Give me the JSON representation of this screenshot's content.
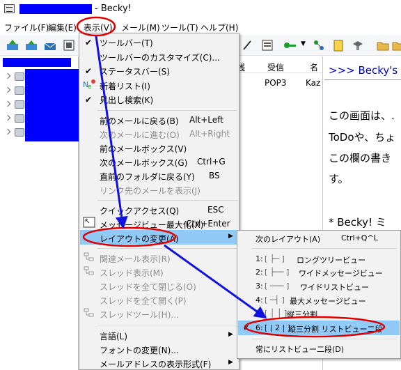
{
  "window": {
    "title_suffix": "- Becky!"
  },
  "menubar": {
    "file": "ファイル(F)",
    "edit": "編集(E)",
    "view": "表示(V)",
    "mail": "メール(M)",
    "tools": "ツール(T)",
    "help": "ヘルプ(H)"
  },
  "list": {
    "columns": [
      "",
      "受信",
      "名"
    ],
    "rows": [
      {
        "type": "POP3",
        "name": "Kaz"
      }
    ]
  },
  "preview": {
    "heading": ">>> Becky's",
    "lines": [
      "この画面は、.",
      "ToDoや、ちょ",
      "この欄の書き",
      "す。",
      "* Becky! ミ"
    ]
  },
  "view_menu": {
    "items": [
      {
        "label": "ツールバー(T)",
        "checked": true,
        "disabled": false
      },
      {
        "label": "ツールバーのカスタマイズ(C)...",
        "checked": false,
        "disabled": false
      },
      {
        "label": "ステータスバー(S)",
        "checked": true,
        "disabled": false
      },
      {
        "label": "新着リスト(I)",
        "checked": false,
        "disabled": false
      },
      {
        "label": "見出し検索(K)",
        "checked": true,
        "disabled": false
      },
      {
        "label": "前のメールに戻る(B)",
        "shortcut": "Alt+Left",
        "disabled": false
      },
      {
        "label": "次のメールに進む(O)",
        "shortcut": "Alt+Right",
        "disabled": true
      },
      {
        "label": "前のメールボックス(V)",
        "disabled": false
      },
      {
        "label": "次のメールボックス(G)",
        "shortcut": "Ctrl+G",
        "disabled": false
      },
      {
        "label": "直前のフォルダに戻る(Y)",
        "shortcut": "BS",
        "disabled": false
      },
      {
        "label": "リンク先のメールを表示(J)",
        "disabled": true
      },
      {
        "label": "クイックアクセス(Q)",
        "shortcut": "ESC",
        "disabled": false
      },
      {
        "label": "メッセージビュー最大化(X)",
        "shortcut": "Ctrl+Enter",
        "disabled": false
      },
      {
        "label": "レイアウトの変更(A)",
        "disabled": false,
        "highlighted": true
      },
      {
        "label": "関連メール表示(R)",
        "disabled": true
      },
      {
        "label": "スレッド表示(M)",
        "disabled": true
      },
      {
        "label": "スレッドを全て閉じる(O)",
        "disabled": true
      },
      {
        "label": "スレッドを全て開く(P)",
        "disabled": true
      },
      {
        "label": "スレッドツール(H)...",
        "disabled": true
      },
      {
        "label": "言語(L)",
        "submenu": true,
        "disabled": false
      },
      {
        "label": "フォントの変更(N)...",
        "disabled": false
      },
      {
        "label": "メールアドレスの表示形式(F)",
        "submenu": true,
        "disabled": false
      }
    ]
  },
  "layout_submenu": {
    "next_layout": {
      "label": "次のレイアウト(A)",
      "shortcut": "Ctrl+Q^L"
    },
    "options": [
      {
        "num": "1:",
        "glyph": "[ ├─ ]",
        "label": "ロングツリービュー"
      },
      {
        "num": "2:",
        "glyph": "[ ├── ]",
        "label": "ワイドメッセージビュー"
      },
      {
        "num": "3:",
        "glyph": "[ ─── ]",
        "label": "ワイドリストビュー"
      },
      {
        "num": "4:",
        "glyph": "[ ─┤ ]",
        "label": "最大メッセージビュー"
      },
      {
        "num": "5:",
        "glyph": "[ │ │ ]",
        "label": "縦三分割"
      },
      {
        "num": "6:",
        "glyph": "[ | 2 | ]",
        "label": "縦三分割 リストビュー二段",
        "checked": true
      }
    ],
    "always_two_rows": "常にリストビュー二段(D)"
  },
  "colors": {
    "redaction": "#0000ff",
    "highlight": "#91c9f7",
    "annotation_red": "#e00000",
    "annotation_arrow": "#1010e0"
  }
}
